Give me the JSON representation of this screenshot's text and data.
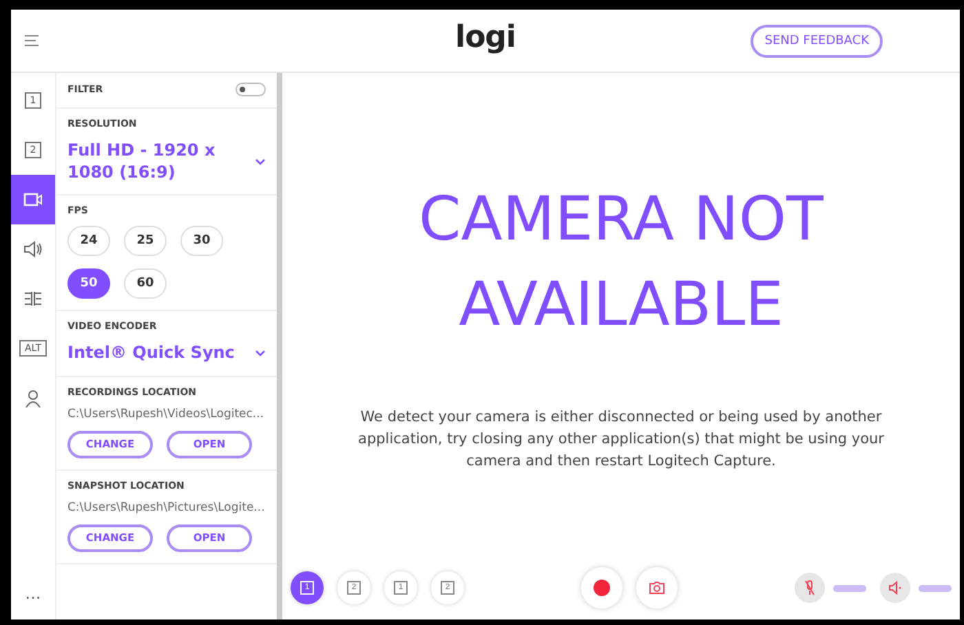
{
  "header": {
    "logo": "logi",
    "feedback_button": "SEND FEEDBACK"
  },
  "rail": [
    {
      "kind": "one",
      "label": "1",
      "selected": false
    },
    {
      "kind": "two",
      "label": "2",
      "selected": false
    },
    {
      "kind": "camera",
      "selected": true
    },
    {
      "kind": "speaker",
      "selected": false
    },
    {
      "kind": "adjust",
      "selected": false
    },
    {
      "kind": "alt",
      "label": "ALT",
      "selected": false
    },
    {
      "kind": "person",
      "selected": false
    }
  ],
  "rail_more": "...",
  "panel": {
    "filter": {
      "label": "FILTER",
      "on": false
    },
    "resolution": {
      "label": "RESOLUTION",
      "value": "Full HD - 1920 x 1080 (16:9)"
    },
    "fps": {
      "label": "FPS",
      "options": [
        {
          "label": "24",
          "selected": false
        },
        {
          "label": "25",
          "selected": false
        },
        {
          "label": "30",
          "selected": false
        },
        {
          "label": "50",
          "selected": true
        },
        {
          "label": "60",
          "selected": false
        }
      ]
    },
    "encoder": {
      "label": "VIDEO ENCODER",
      "value": "Intel® Quick Sync"
    },
    "locations": [
      {
        "label": "RECORDINGS LOCATION",
        "path": "C:\\Users\\Rupesh\\Videos\\Logitec...",
        "buttons": [
          "CHANGE",
          "OPEN"
        ]
      },
      {
        "label": "SNAPSHOT LOCATION",
        "path": "C:\\Users\\Rupesh\\Pictures\\Logite...",
        "buttons": [
          "CHANGE",
          "OPEN"
        ]
      }
    ]
  },
  "main": {
    "title": "CAMERA NOT AVAILABLE",
    "message": "We detect your camera is either disconnected or being used by another application, try closing any other application(s) that might be using your camera and then restart Logitech Capture."
  },
  "toolbar": {
    "layouts": [
      {
        "label": "1",
        "selected": true
      },
      {
        "label": "2",
        "selected": false
      },
      {
        "label": "1",
        "selected": false
      },
      {
        "label": "2",
        "selected": false
      }
    ],
    "audio": [
      {
        "kind": "mic",
        "level": 1
      },
      {
        "kind": "speaker",
        "level": 1
      }
    ]
  }
}
